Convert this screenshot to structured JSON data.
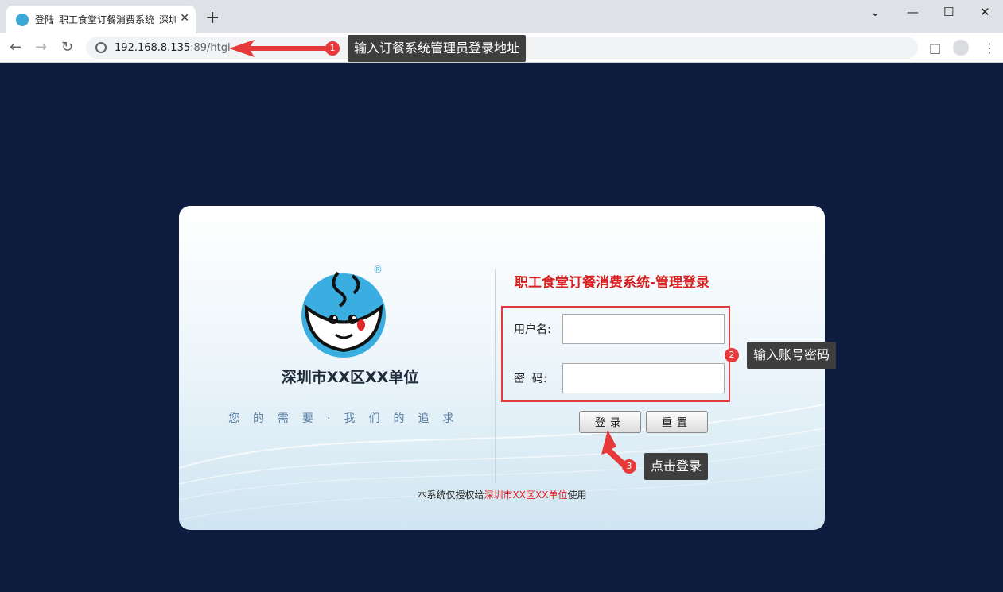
{
  "browser": {
    "tab_title": "登陆_职工食堂订餐消费系统_深圳",
    "tab_close": "✕",
    "new_tab": "+",
    "url_host": "192.168.8.135",
    "url_path": ":89/htgl",
    "window_controls": {
      "minimize": "⌄",
      "restore": "—",
      "maximize": "☐",
      "close": "✕"
    }
  },
  "annotations": [
    {
      "num": "1",
      "text": "输入订餐系统管理员登录地址"
    },
    {
      "num": "2",
      "text": "输入账号密码"
    },
    {
      "num": "3",
      "text": "点击登录"
    }
  ],
  "login": {
    "logo_mark": "®",
    "org_name": "深圳市XX区XX单位",
    "slogan": "您的需要·我们的追求",
    "title": "职工食堂订餐消费系统-管理登录",
    "username_label": "用户名:",
    "password_label": "密  码:",
    "username_value": "",
    "password_value": "",
    "login_button": "登录",
    "reset_button": "重置",
    "footer_prefix": "本系统仅授权给",
    "footer_org": "深圳市XX区XX单位",
    "footer_suffix": "使用"
  },
  "colors": {
    "page_bg": "#0e1c3f",
    "accent_red": "#d81e1e",
    "annotation_red": "#e8393a"
  }
}
